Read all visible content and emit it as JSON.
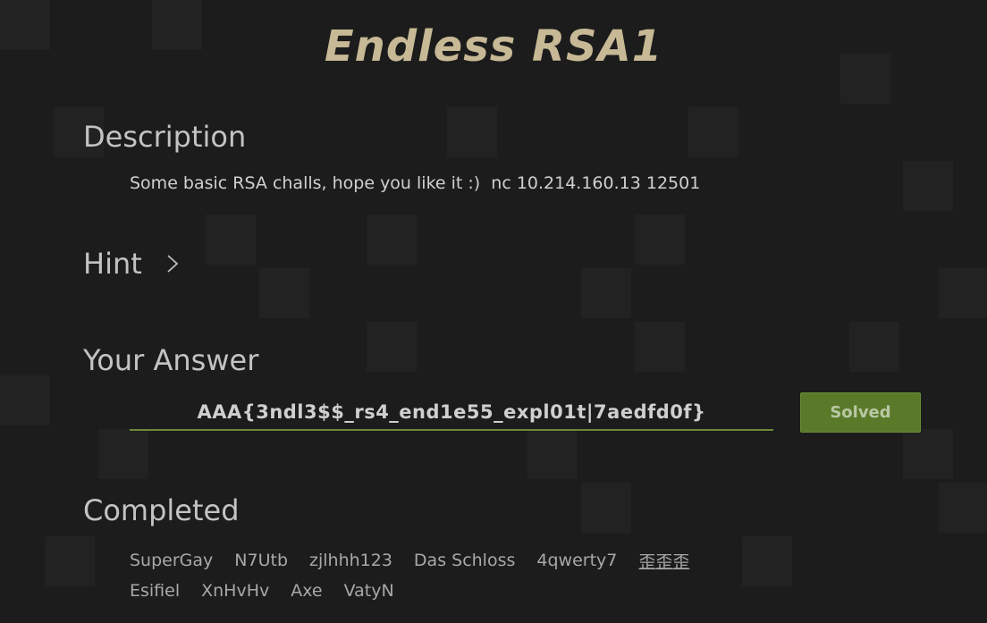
{
  "title": "Endless RSA1",
  "description": {
    "heading": "Description",
    "text": "Some basic RSA challs, hope you like it :)  nc 10.214.160.13 12501"
  },
  "hint": {
    "heading": "Hint",
    "icon": "chevron-right-icon"
  },
  "answer": {
    "heading": "Your Answer",
    "value": "AAA{3ndl3$$_rs4_end1e55_expl01t|7aedfd0f}",
    "button_label": "Solved"
  },
  "completed": {
    "heading": "Completed",
    "rows": [
      [
        "SuperGay",
        "N7Utb",
        "zjlhhh123",
        "Das Schloss",
        "4qwerty7",
        "歪歪歪"
      ],
      [
        "Esifiel",
        "XnHvHv",
        "Axe",
        "VatyN"
      ]
    ]
  },
  "colors": {
    "background": "#1c1c1c",
    "title": "#c7b995",
    "accent_green": "#5a7a2a"
  }
}
